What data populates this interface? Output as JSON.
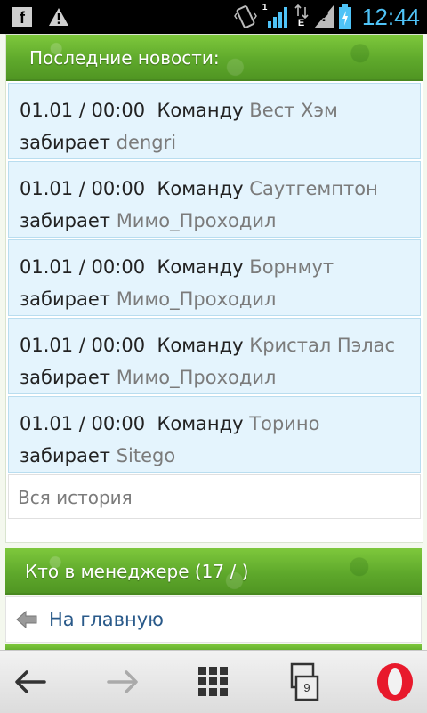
{
  "status_bar": {
    "time": "12:44",
    "network_label": "E",
    "sim_label": "1",
    "unknown_label": "?",
    "icons": [
      "facebook-icon",
      "warning-icon",
      "vibrate-icon",
      "signal-icon",
      "data-icon",
      "unknown-signal-icon",
      "battery-icon"
    ]
  },
  "news": {
    "header": "Последние новости:",
    "items": [
      {
        "time": "01.01 / 00:00",
        "verb1": "Команду",
        "team": "Вест Хэм",
        "verb2": "забирает",
        "user": "dengri"
      },
      {
        "time": "01.01 / 00:00",
        "verb1": "Команду",
        "team": "Саутгемптон",
        "verb2": "забирает",
        "user": "Мимо_Проходил"
      },
      {
        "time": "01.01 / 00:00",
        "verb1": "Команду",
        "team": "Борнмут",
        "verb2": "забирает",
        "user": "Мимо_Проходил"
      },
      {
        "time": "01.01 / 00:00",
        "verb1": "Команду",
        "team": "Кристал Пэлас",
        "verb2": "забирает",
        "user": "Мимо_Проходил"
      },
      {
        "time": "01.01 / 00:00",
        "verb1": "Команду",
        "team": "Торино",
        "verb2": "забирает",
        "user": "Sitego"
      }
    ],
    "history_link": "Вся история"
  },
  "managers": {
    "header": "Кто в менеджере (17 / )"
  },
  "home_link": "На главную",
  "bottom_bar": {
    "tab_count": "9",
    "icons": [
      "back-arrow-icon",
      "forward-arrow-icon",
      "grid-icon",
      "tabs-icon",
      "opera-icon"
    ]
  },
  "colors": {
    "grass": "#5ea82b",
    "news_bg": "#e4f4fd",
    "news_border": "#b9ddef",
    "link": "#2a5a8a",
    "time": "#4fc3f7",
    "opera": "#e8192c"
  }
}
